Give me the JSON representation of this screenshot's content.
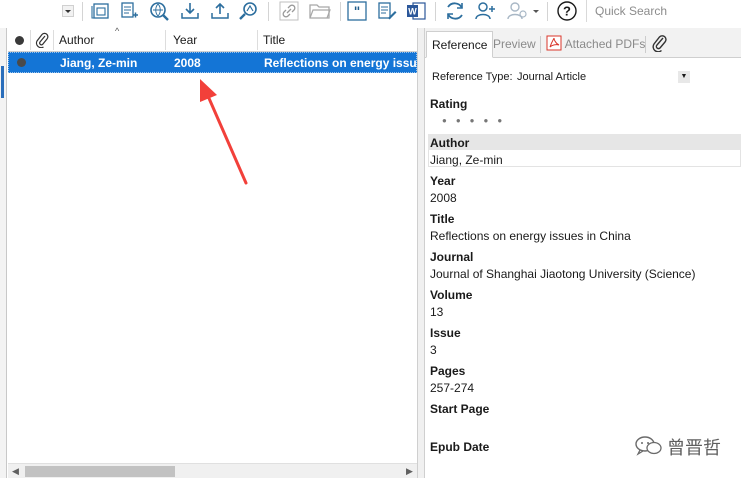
{
  "toolbar": {
    "search_placeholder": "Quick Search",
    "icons": [
      "dropdown-arrow-icon",
      "new-group-icon",
      "new-reference-icon",
      "online-search-icon",
      "import-icon",
      "export-icon",
      "find-full-text-icon",
      "link-icon",
      "open-folder-icon",
      "insert-citation-icon",
      "edit-reference-icon",
      "word-icon",
      "sync-icon",
      "share-user-icon",
      "user-icon",
      "help-icon"
    ]
  },
  "table": {
    "columns": {
      "author": "Author",
      "year": "Year",
      "title": "Title"
    },
    "rows": [
      {
        "author": "Jiang, Ze-min",
        "year": "2008",
        "title": "Reflections on energy issues in China"
      }
    ]
  },
  "tabs": {
    "reference": "Reference",
    "preview": "Preview",
    "attached_pdfs": "Attached PDFs"
  },
  "reference": {
    "type_label": "Reference Type:",
    "type_value": "Journal Article",
    "rating_label": "Rating",
    "rating_stars": 0,
    "fields": {
      "author_label": "Author",
      "author_value": "Jiang, Ze-min",
      "year_label": "Year",
      "year_value": "2008",
      "title_label": "Title",
      "title_value": "Reflections on energy issues in China",
      "journal_label": "Journal",
      "journal_value": "Journal of Shanghai Jiaotong University (Science)",
      "volume_label": "Volume",
      "volume_value": "13",
      "issue_label": "Issue",
      "issue_value": "3",
      "pages_label": "Pages",
      "pages_value": "257-274",
      "start_page_label": "Start Page",
      "epub_date_label": "Epub Date"
    }
  },
  "watermark": {
    "text": "曾晋哲"
  },
  "colors": {
    "selection": "#1475d6",
    "arrow": "#f2403a",
    "accent_blue": "#2a6ebb"
  }
}
